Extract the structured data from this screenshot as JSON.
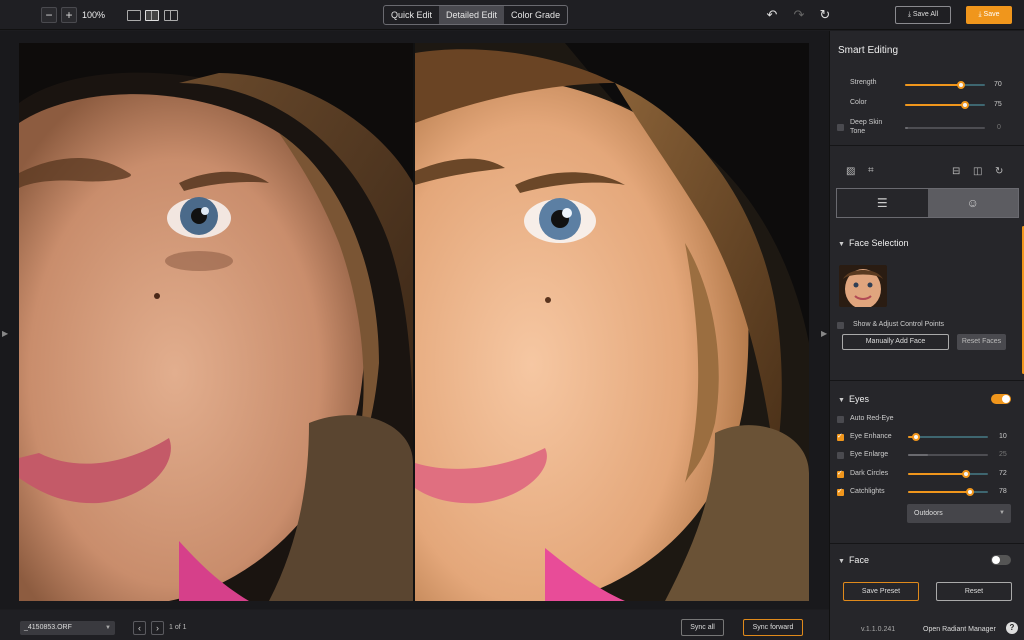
{
  "toolbar": {
    "zoom_out_icon": "minus-icon",
    "zoom_in_icon": "plus-icon",
    "zoom_level": "100%",
    "view_modes": [
      "single-view-icon",
      "split-view-icon",
      "compare-view-icon"
    ],
    "tabs": [
      {
        "label": "Quick Edit",
        "active": false
      },
      {
        "label": "Detailed Edit",
        "active": true
      },
      {
        "label": "Color Grade",
        "active": false
      }
    ],
    "undo_icon": "undo-icon",
    "redo_icon": "redo-icon",
    "reset_icon": "reset-icon",
    "save_all_label": "Save All",
    "save_label": "Save"
  },
  "bottombar": {
    "file_name": "_4150853.ORF",
    "page_count": "1 of 1",
    "sync_all_label": "Sync all",
    "sync_forward_label": "Sync forward"
  },
  "panel": {
    "title": "Smart Editing",
    "smart_sliders": [
      {
        "label": "Strength",
        "value": "70",
        "fraction": 0.7
      },
      {
        "label": "Color",
        "value": "75",
        "fraction": 0.75
      }
    ],
    "deep_skin_label_1": "Deep Skin",
    "deep_skin_label_2": "Tone",
    "deep_skin_value": "0",
    "face_selection": {
      "title": "Face Selection",
      "show_points_label": "Show & Adjust Control Points",
      "manual_add_label": "Manually Add Face",
      "reset_faces_label": "Reset Faces"
    },
    "eyes": {
      "title": "Eyes",
      "auto_red_eye_label": "Auto Red-Eye",
      "sliders": [
        {
          "label": "Eye Enhance",
          "value": "10",
          "fraction": 0.1,
          "checked": true
        },
        {
          "label": "Eye Enlarge",
          "value": "25",
          "fraction": 0.25,
          "checked": false
        },
        {
          "label": "Dark Circles",
          "value": "72",
          "fraction": 0.72,
          "checked": true
        },
        {
          "label": "Catchlights",
          "value": "78",
          "fraction": 0.78,
          "checked": true
        }
      ],
      "catchlight_preset": "Outdoors"
    },
    "face": {
      "title": "Face"
    },
    "save_preset_label": "Save Preset",
    "reset_label": "Reset",
    "version": "v.1.1.0.241",
    "open_rm_label": "Open Radiant Manager",
    "help_label": "?"
  },
  "colors": {
    "accent": "#f0961c",
    "panel_bg": "#26262a"
  }
}
